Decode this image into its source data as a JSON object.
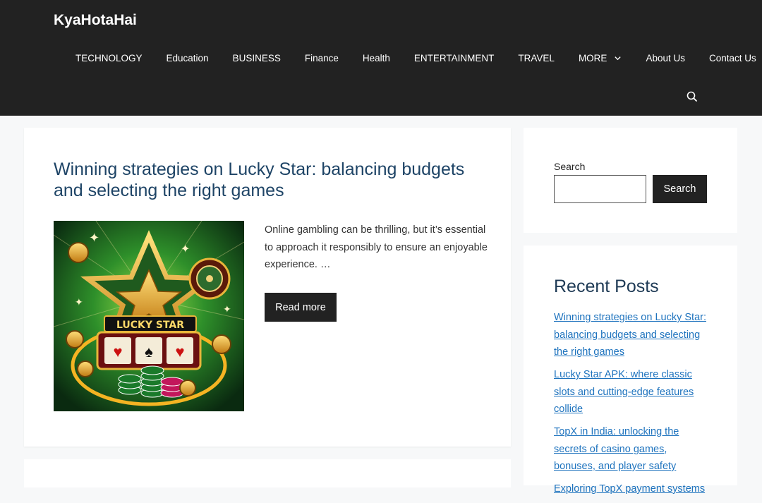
{
  "site": {
    "title": "KyaHotaHai"
  },
  "nav": {
    "items": [
      {
        "label": "TECHNOLOGY"
      },
      {
        "label": "Education"
      },
      {
        "label": "BUSINESS"
      },
      {
        "label": "Finance"
      },
      {
        "label": "Health"
      },
      {
        "label": "ENTERTAINMENT"
      },
      {
        "label": "TRAVEL"
      },
      {
        "label": "MORE",
        "dropdown": true
      },
      {
        "label": "About Us"
      },
      {
        "label": "Contact Us"
      }
    ],
    "search_icon": "search-icon"
  },
  "article": {
    "title": "Winning strategies on Lucky Star: balancing budgets and selecting the right games",
    "thumbnail_text": "LUCKY STAR",
    "excerpt": "Online gambling can be thrilling, but it’s essential to approach it responsibly to ensure an enjoyable experience. …",
    "read_more": "Read more"
  },
  "sidebar": {
    "search": {
      "label": "Search",
      "placeholder": "",
      "value": "",
      "button": "Search"
    },
    "recent": {
      "title": "Recent Posts",
      "posts": [
        {
          "title": "Winning strategies on Lucky Star: balancing budgets and selecting the right games"
        },
        {
          "title": "Lucky Star APK: where classic slots and cutting-edge features collide"
        },
        {
          "title": "TopX in India: unlocking the secrets of casino games, bonuses, and player safety"
        },
        {
          "title": "Exploring TopX payment systems"
        }
      ]
    }
  },
  "colors": {
    "header_bg": "#222222",
    "title_color": "#1e4466",
    "link_color": "#1e73be",
    "button_bg": "#222222",
    "page_bg": "#f7f8f9"
  }
}
